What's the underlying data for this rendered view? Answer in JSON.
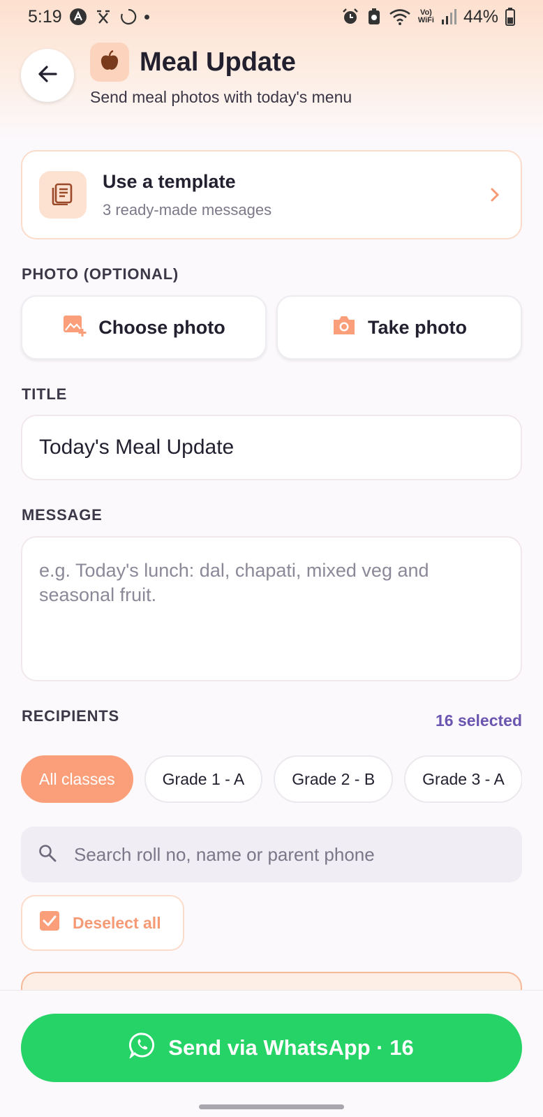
{
  "status_bar": {
    "time": "5:19",
    "battery": "44%",
    "volte": "Vo)",
    "wifi_label": "WiFi"
  },
  "header": {
    "title": "Meal Update",
    "subtitle": "Send meal photos with today's menu"
  },
  "template_card": {
    "title": "Use a template",
    "subtitle": "3 ready-made messages"
  },
  "photo": {
    "label": "PHOTO (OPTIONAL)",
    "choose_label": "Choose photo",
    "take_label": "Take photo"
  },
  "title_field": {
    "label": "TITLE",
    "value": "Today's Meal Update"
  },
  "message_field": {
    "label": "MESSAGE",
    "placeholder": "e.g. Today's lunch: dal, chapati, mixed veg and seasonal fruit."
  },
  "recipients": {
    "label": "RECIPIENTS",
    "selected_text": "16 selected",
    "chips": [
      "All classes",
      "Grade 1 - A",
      "Grade 2 - B",
      "Grade 3 - A"
    ],
    "active_chip": "All classes",
    "search_placeholder": "Search roll no, name or parent phone",
    "deselect_label": "Deselect all"
  },
  "send_button": {
    "label": "Send via WhatsApp · 16"
  },
  "colors": {
    "accent": "#fb9f7a",
    "whatsapp_green": "#25d366",
    "selected_purple": "#6a55b0"
  },
  "icons": {
    "back": "arrow-left-icon",
    "header": "apple-icon",
    "template": "document-icon",
    "choose_photo": "image-add-icon",
    "take_photo": "camera-icon",
    "search": "search-icon",
    "checkbox": "checkbox-checked-icon",
    "whatsapp": "whatsapp-icon"
  }
}
